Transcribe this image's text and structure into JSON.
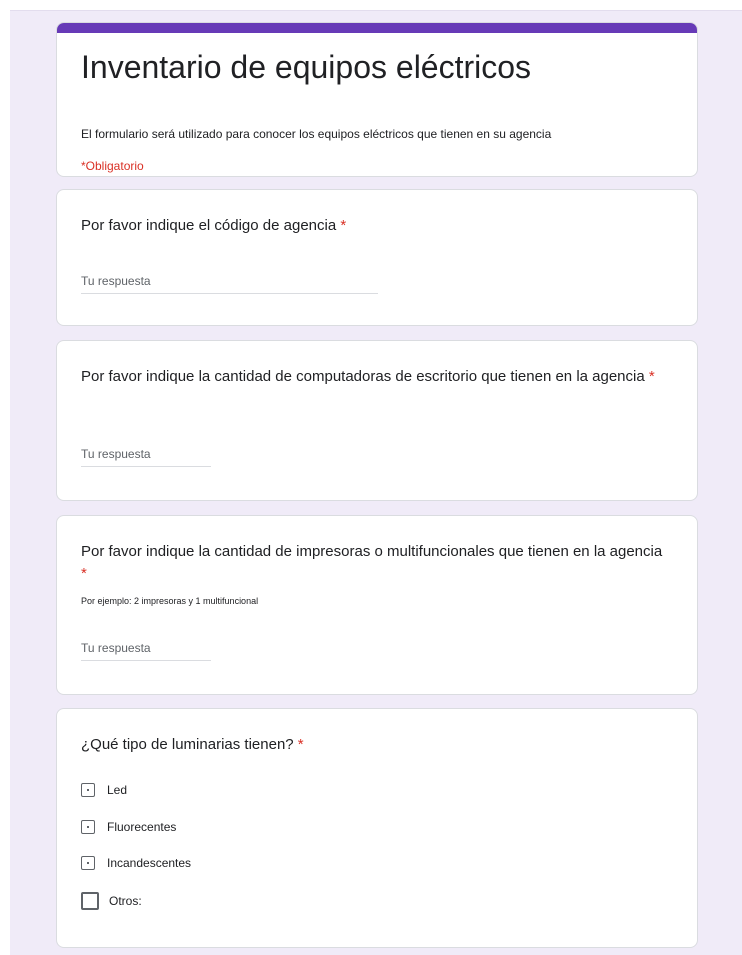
{
  "form": {
    "title": "Inventario de equipos eléctricos",
    "description": "El formulario será utilizado para conocer los equipos eléctricos que tienen en su agencia",
    "required_note": "*Obligatorio",
    "accent_color": "#673ab7",
    "background_color": "#f0ebf8",
    "required_color": "#d93025"
  },
  "questions": [
    {
      "title": "Por favor indique el código de agencia",
      "required_marker": "*",
      "placeholder": "Tu respuesta"
    },
    {
      "title": "Por favor indique la cantidad de computadoras de escritorio que tienen en la agencia",
      "required_marker": "*",
      "placeholder": "Tu respuesta"
    },
    {
      "title": "Por favor indique la cantidad de impresoras o multifuncionales que tienen en la agencia",
      "required_marker": "*",
      "help": "Por ejemplo: 2 impresoras y 1 multifuncional",
      "placeholder": "Tu respuesta"
    },
    {
      "title": "¿Qué tipo de luminarias tienen?",
      "required_marker": "*",
      "options": [
        {
          "label": "Led",
          "checked": false
        },
        {
          "label": "Fluorecentes",
          "checked": false
        },
        {
          "label": "Incandescentes",
          "checked": false
        },
        {
          "label": "Otros:",
          "checked": false
        }
      ]
    }
  ]
}
